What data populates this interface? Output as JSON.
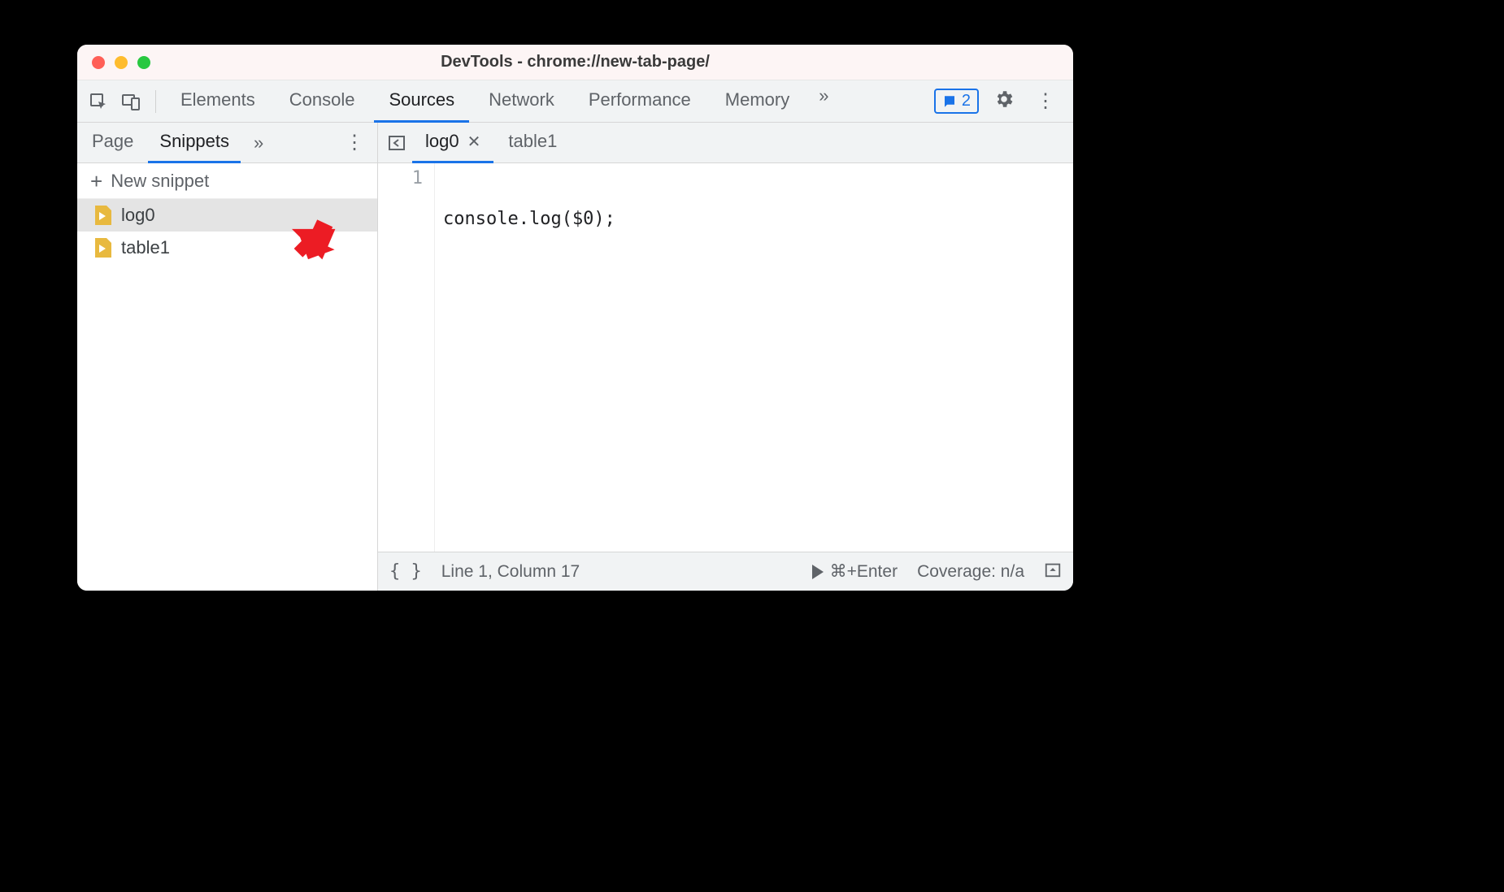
{
  "window": {
    "title": "DevTools - chrome://new-tab-page/"
  },
  "toolbar": {
    "tabs": [
      "Elements",
      "Console",
      "Sources",
      "Network",
      "Performance",
      "Memory"
    ],
    "active_tab_index": 2,
    "message_count": "2"
  },
  "sidebar": {
    "tabs": [
      "Page",
      "Snippets"
    ],
    "active_tab_index": 1,
    "new_snippet_label": "New snippet",
    "snippets": [
      "log0",
      "table1"
    ],
    "selected_index": 0
  },
  "editor": {
    "open_files": [
      "log0",
      "table1"
    ],
    "active_file_index": 0,
    "lines": [
      {
        "n": "1",
        "text": "console.log($0);"
      }
    ]
  },
  "statusbar": {
    "cursor": "Line 1, Column 17",
    "run_hint": "⌘+Enter",
    "coverage": "Coverage: n/a"
  },
  "annotation": {
    "type": "red-arrow",
    "target": "snippet-item-log0"
  }
}
